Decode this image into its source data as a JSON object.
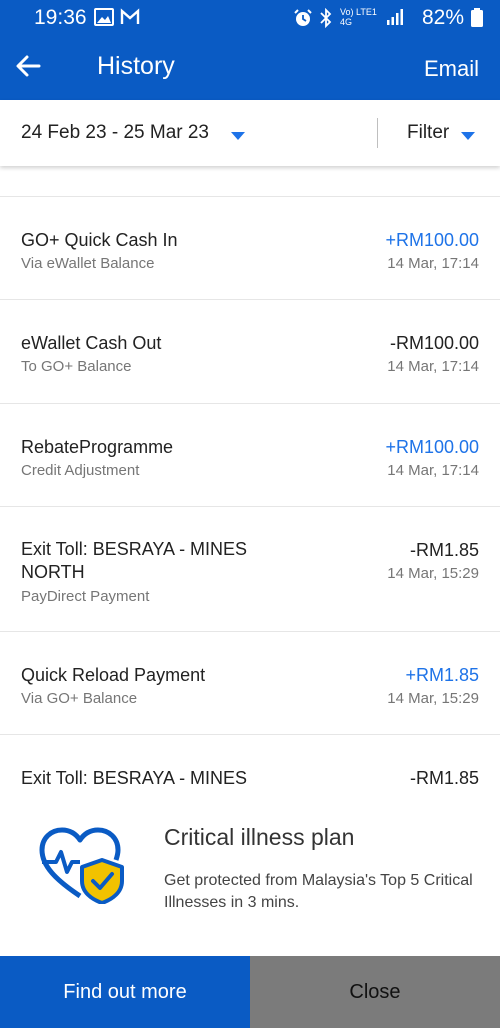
{
  "status_bar": {
    "time": "19:36",
    "network_label": "Vo) LTE1 4G",
    "battery": "82%",
    "icons": [
      "image-icon",
      "gmail-icon",
      "alarm-icon",
      "bluetooth-icon",
      "signal-icon",
      "battery-icon"
    ]
  },
  "app_bar": {
    "title": "History",
    "back_icon": "arrow-left-icon",
    "email_label": "Email"
  },
  "date_filter": {
    "range": "24 Feb 23 - 25 Mar 23",
    "filter_label": "Filter"
  },
  "transactions": [
    {
      "title": "GO+ Quick Cash In",
      "subtitle": "Via eWallet Balance",
      "amount": "+RM100.00",
      "date": "14 Mar, 17:14",
      "direction": "in"
    },
    {
      "title": "eWallet Cash Out",
      "subtitle": "To GO+ Balance",
      "amount": "-RM100.00",
      "date": "14 Mar, 17:14",
      "direction": "out"
    },
    {
      "title": "RebateProgramme",
      "subtitle": "Credit Adjustment",
      "amount": "+RM100.00",
      "date": "14 Mar, 17:14",
      "direction": "in"
    },
    {
      "title": "Exit Toll: BESRAYA - MINES NORTH",
      "subtitle": "PayDirect Payment",
      "amount": "-RM1.85",
      "date": "14 Mar, 15:29",
      "direction": "out"
    },
    {
      "title": "Quick Reload Payment",
      "subtitle": "Via GO+ Balance",
      "amount": "+RM1.85",
      "date": "14 Mar, 15:29",
      "direction": "in"
    },
    {
      "title": "Exit Toll: BESRAYA - MINES",
      "subtitle": "",
      "amount": "-RM1.85",
      "date": "",
      "direction": "out"
    }
  ],
  "promo": {
    "icon": "heart-shield-check-icon",
    "title": "Critical illness plan",
    "text": "Get protected from Malaysia's Top 5 Critical Illnesses in 3 mins."
  },
  "actions": {
    "find_out_more": "Find out more",
    "close": "Close"
  },
  "colors": {
    "primary": "#0a5bc4",
    "positive_amount": "#1e73e8",
    "close_button": "#7b7b7b",
    "promo_shield": "#f2c200"
  }
}
